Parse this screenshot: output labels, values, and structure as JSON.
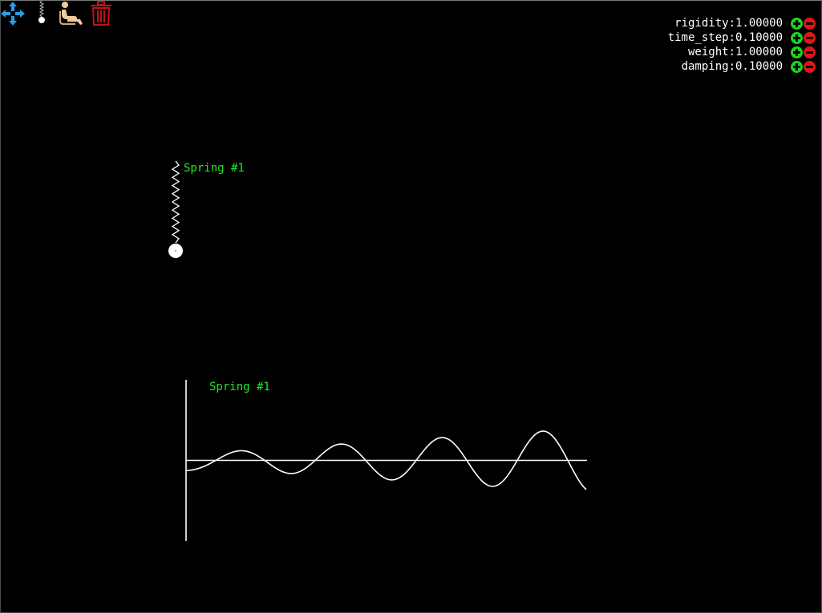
{
  "toolbar": {
    "tools": [
      {
        "name": "move-icon",
        "color": "#2a9be8"
      },
      {
        "name": "spring-weight-icon",
        "color": "#ffffff"
      },
      {
        "name": "seated-person-icon",
        "color": "#f3c99a"
      },
      {
        "name": "trash-icon",
        "color": "#c0121a"
      }
    ]
  },
  "params": [
    {
      "text": "rigidity:1.00000"
    },
    {
      "text": "time_step:0.10000"
    },
    {
      "text": "weight:1.00000"
    },
    {
      "text": "damping:0.10000"
    }
  ],
  "scene": {
    "spring_label": "Spring #1",
    "graph_label": "Spring #1"
  },
  "colors": {
    "background": "#000000",
    "text": "#ffffff",
    "label": "#22e822",
    "plus": "#20d020",
    "minus": "#e01515"
  }
}
